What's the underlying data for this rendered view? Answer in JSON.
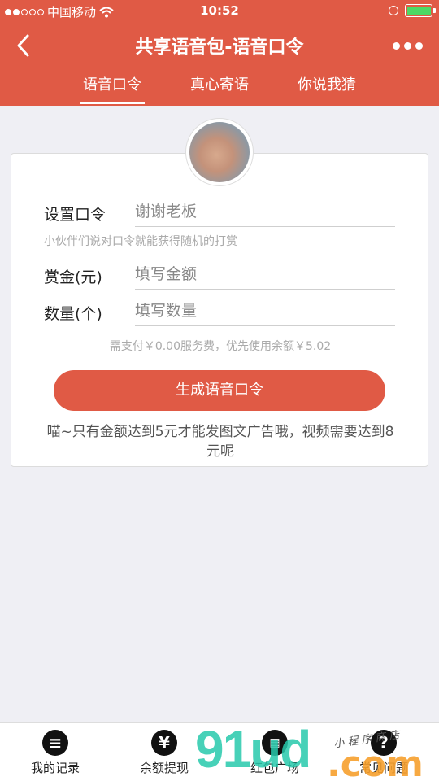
{
  "status": {
    "carrier": "中国移动",
    "time": "10:52"
  },
  "header": {
    "title": "共享语音包-语音口令"
  },
  "tabs": [
    {
      "label": "语音口令"
    },
    {
      "label": "真心寄语"
    },
    {
      "label": "你说我猜"
    }
  ],
  "form": {
    "command_label": "设置口令",
    "command_value": "谢谢老板",
    "command_hint": "小伙伴们说对口令就能获得随机的打赏",
    "reward_label": "赏金(元)",
    "reward_placeholder": "填写金额",
    "count_label": "数量(个)",
    "count_placeholder": "填写数量",
    "fee_text": "需支付￥0.00服务费，优先使用余额￥5.02",
    "submit_label": "生成语音口令",
    "note": "喵~只有金额达到5元才能发图文广告哦，视频需要达到8元呢"
  },
  "tabbar": [
    {
      "label": "我的记录",
      "icon": "list-icon"
    },
    {
      "label": "余额提现",
      "icon": "yen-icon"
    },
    {
      "label": "红包广场",
      "icon": "grid-icon"
    },
    {
      "label": "常见问题",
      "icon": "question-icon"
    }
  ],
  "watermark": {
    "text": "91ud",
    "suffix": ".com",
    "small": "小 程 序 商 店"
  },
  "colors": {
    "accent": "#e05a45",
    "battery": "#4cd964"
  }
}
